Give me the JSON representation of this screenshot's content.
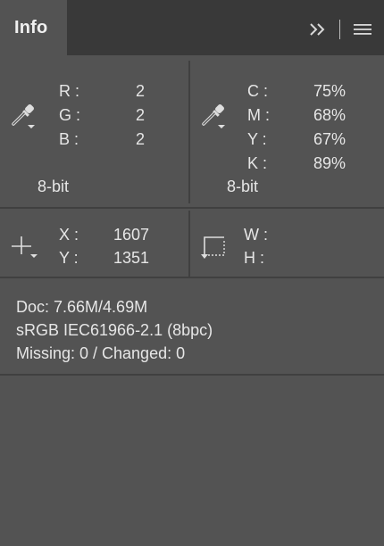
{
  "panel": {
    "tab_label": "Info",
    "icons": {
      "expand": "double-chevron-right-icon",
      "menu": "hamburger-menu-icon"
    }
  },
  "rgb": {
    "icon": "eyedropper-icon",
    "labels": [
      "R :",
      "G :",
      "B :"
    ],
    "values": [
      "2",
      "2",
      "2"
    ],
    "bit_depth": "8-bit"
  },
  "cmyk": {
    "icon": "eyedropper-icon",
    "labels": [
      "C :",
      "M :",
      "Y :",
      "K :"
    ],
    "values": [
      "75%",
      "68%",
      "67%",
      "89%"
    ],
    "bit_depth": "8-bit"
  },
  "position": {
    "icon": "crosshair-icon",
    "labels": [
      "X :",
      "Y :"
    ],
    "values": [
      "1607",
      "1351"
    ]
  },
  "selection_size": {
    "icon": "selection-size-icon",
    "labels": [
      "W :",
      "H :"
    ]
  },
  "document_info": {
    "doc_size": "Doc: 7.66M/4.69M",
    "color_profile": "sRGB IEC61966-2.1 (8bpc)",
    "fonts_status": "Missing: 0 / Changed: 0"
  },
  "colors": {
    "panel_bg": "#535353",
    "tabbar_bg": "#393939",
    "divider": "#404040",
    "text": "#e6e6e6"
  }
}
